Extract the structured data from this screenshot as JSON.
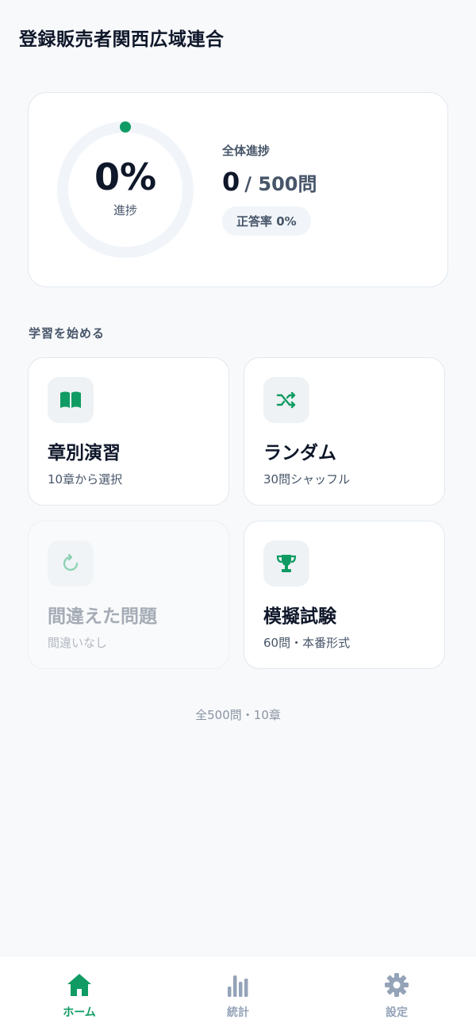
{
  "header": {
    "title": "登録販売者関西広域連合"
  },
  "progress": {
    "percent_text": "0%",
    "percent_value": 0,
    "ring_label": "進捗",
    "overall_title": "全体進捗",
    "answered": "0",
    "total": "/ 500問",
    "accuracy": "正答率 0%"
  },
  "section": {
    "title": "学習を始める"
  },
  "modes": [
    {
      "title": "章別演習",
      "subtitle": "10章から選択",
      "icon": "open-book-icon",
      "enabled": true
    },
    {
      "title": "ランダム",
      "subtitle": "30問シャッフル",
      "icon": "shuffle-icon",
      "enabled": true
    },
    {
      "title": "間違えた問題",
      "subtitle": "間違いなし",
      "icon": "refresh-icon",
      "enabled": false
    },
    {
      "title": "模擬試験",
      "subtitle": "60問・本番形式",
      "icon": "trophy-icon",
      "enabled": true
    }
  ],
  "footer": {
    "summary": "全500問・10章"
  },
  "tabbar": {
    "items": [
      {
        "label": "ホーム",
        "icon": "home-icon",
        "active": true
      },
      {
        "label": "統計",
        "icon": "bar-chart-icon",
        "active": false
      },
      {
        "label": "設定",
        "icon": "gear-icon",
        "active": false
      }
    ]
  },
  "colors": {
    "accent": "#0f9b63",
    "inactive_tab": "#94a3b8",
    "text_primary": "#0f172a",
    "text_secondary": "#475569",
    "ring_track": "#f1f5f9"
  }
}
